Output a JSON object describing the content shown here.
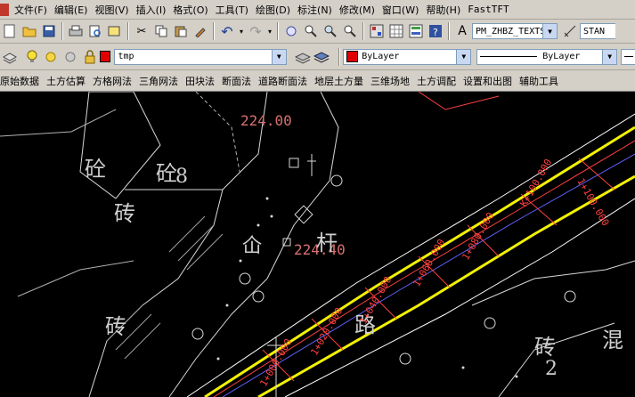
{
  "menubar": {
    "items": [
      "文件(F)",
      "编辑(E)",
      "视图(V)",
      "插入(I)",
      "格式(O)",
      "工具(T)",
      "绘图(D)",
      "标注(N)",
      "修改(M)",
      "窗口(W)",
      "帮助(H)",
      "FastTFT"
    ]
  },
  "toolbar": {
    "text_style": "PM_ZHBZ_TEXTS",
    "dim_style": "STAN"
  },
  "layers": {
    "current_layer": "tmp",
    "color": "ByLayer",
    "linetype": "ByLayer",
    "layer_color_hex": "#e00000"
  },
  "plugin_menu": {
    "items": [
      "原始数据",
      "土方估算",
      "方格网法",
      "三角网法",
      "田块法",
      "断面法",
      "道路断面法",
      "地层土方量",
      "三维场地",
      "土方调配",
      "设置和出图",
      "辅助工具"
    ]
  },
  "drawing": {
    "elevation_1": "224.00",
    "elevation_2": "224.40",
    "symbol_concrete": "砼",
    "symbol_brick": "砖",
    "symbol_mixed": "混",
    "label_8": "8",
    "label_2": "2",
    "symbol_pole": "杆",
    "symbol_temple": "仚",
    "road_char": "路",
    "stations": [
      "K+100.000",
      "1+100.000",
      "1+080.000",
      "1+060.000",
      "1+040.000",
      "1+020.000",
      "1+000.000"
    ]
  }
}
